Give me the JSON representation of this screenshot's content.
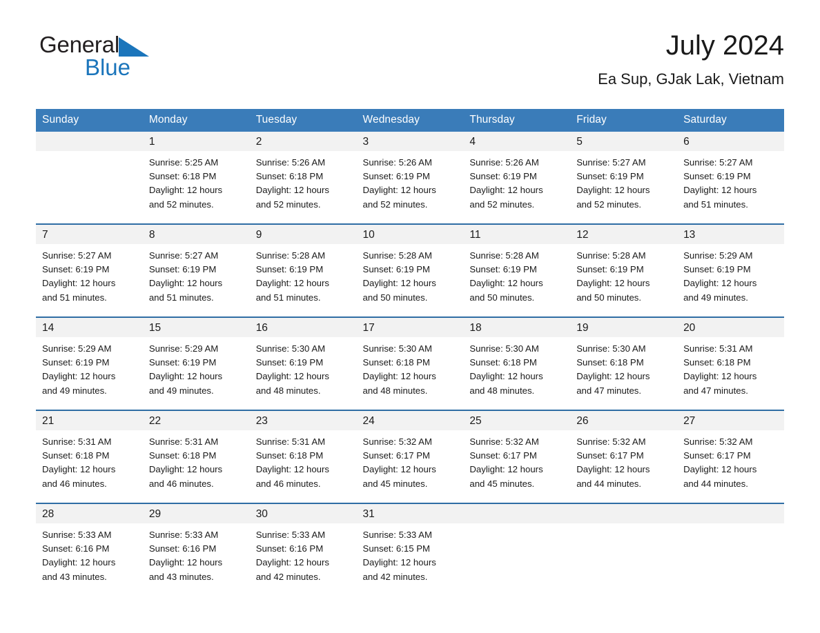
{
  "brand": {
    "name_part1": "General",
    "name_part2": "Blue",
    "accent_color": "#1b75bb",
    "triangle_icon": "brand-triangle-icon"
  },
  "header": {
    "title": "July 2024",
    "subtitle": "Ea Sup, GJak Lak, Vietnam"
  },
  "calendar": {
    "header_bg": "#3a7cb9",
    "row_divider_color": "#2e6da4",
    "daynum_band_bg": "#f2f2f2",
    "weekday_headers": [
      "Sunday",
      "Monday",
      "Tuesday",
      "Wednesday",
      "Thursday",
      "Friday",
      "Saturday"
    ],
    "weeks": [
      [
        {
          "day": "",
          "details": ""
        },
        {
          "day": "1",
          "details": "Sunrise: 5:25 AM\nSunset: 6:18 PM\nDaylight: 12 hours\nand 52 minutes."
        },
        {
          "day": "2",
          "details": "Sunrise: 5:26 AM\nSunset: 6:18 PM\nDaylight: 12 hours\nand 52 minutes."
        },
        {
          "day": "3",
          "details": "Sunrise: 5:26 AM\nSunset: 6:19 PM\nDaylight: 12 hours\nand 52 minutes."
        },
        {
          "day": "4",
          "details": "Sunrise: 5:26 AM\nSunset: 6:19 PM\nDaylight: 12 hours\nand 52 minutes."
        },
        {
          "day": "5",
          "details": "Sunrise: 5:27 AM\nSunset: 6:19 PM\nDaylight: 12 hours\nand 52 minutes."
        },
        {
          "day": "6",
          "details": "Sunrise: 5:27 AM\nSunset: 6:19 PM\nDaylight: 12 hours\nand 51 minutes."
        }
      ],
      [
        {
          "day": "7",
          "details": "Sunrise: 5:27 AM\nSunset: 6:19 PM\nDaylight: 12 hours\nand 51 minutes."
        },
        {
          "day": "8",
          "details": "Sunrise: 5:27 AM\nSunset: 6:19 PM\nDaylight: 12 hours\nand 51 minutes."
        },
        {
          "day": "9",
          "details": "Sunrise: 5:28 AM\nSunset: 6:19 PM\nDaylight: 12 hours\nand 51 minutes."
        },
        {
          "day": "10",
          "details": "Sunrise: 5:28 AM\nSunset: 6:19 PM\nDaylight: 12 hours\nand 50 minutes."
        },
        {
          "day": "11",
          "details": "Sunrise: 5:28 AM\nSunset: 6:19 PM\nDaylight: 12 hours\nand 50 minutes."
        },
        {
          "day": "12",
          "details": "Sunrise: 5:28 AM\nSunset: 6:19 PM\nDaylight: 12 hours\nand 50 minutes."
        },
        {
          "day": "13",
          "details": "Sunrise: 5:29 AM\nSunset: 6:19 PM\nDaylight: 12 hours\nand 49 minutes."
        }
      ],
      [
        {
          "day": "14",
          "details": "Sunrise: 5:29 AM\nSunset: 6:19 PM\nDaylight: 12 hours\nand 49 minutes."
        },
        {
          "day": "15",
          "details": "Sunrise: 5:29 AM\nSunset: 6:19 PM\nDaylight: 12 hours\nand 49 minutes."
        },
        {
          "day": "16",
          "details": "Sunrise: 5:30 AM\nSunset: 6:19 PM\nDaylight: 12 hours\nand 48 minutes."
        },
        {
          "day": "17",
          "details": "Sunrise: 5:30 AM\nSunset: 6:18 PM\nDaylight: 12 hours\nand 48 minutes."
        },
        {
          "day": "18",
          "details": "Sunrise: 5:30 AM\nSunset: 6:18 PM\nDaylight: 12 hours\nand 48 minutes."
        },
        {
          "day": "19",
          "details": "Sunrise: 5:30 AM\nSunset: 6:18 PM\nDaylight: 12 hours\nand 47 minutes."
        },
        {
          "day": "20",
          "details": "Sunrise: 5:31 AM\nSunset: 6:18 PM\nDaylight: 12 hours\nand 47 minutes."
        }
      ],
      [
        {
          "day": "21",
          "details": "Sunrise: 5:31 AM\nSunset: 6:18 PM\nDaylight: 12 hours\nand 46 minutes."
        },
        {
          "day": "22",
          "details": "Sunrise: 5:31 AM\nSunset: 6:18 PM\nDaylight: 12 hours\nand 46 minutes."
        },
        {
          "day": "23",
          "details": "Sunrise: 5:31 AM\nSunset: 6:18 PM\nDaylight: 12 hours\nand 46 minutes."
        },
        {
          "day": "24",
          "details": "Sunrise: 5:32 AM\nSunset: 6:17 PM\nDaylight: 12 hours\nand 45 minutes."
        },
        {
          "day": "25",
          "details": "Sunrise: 5:32 AM\nSunset: 6:17 PM\nDaylight: 12 hours\nand 45 minutes."
        },
        {
          "day": "26",
          "details": "Sunrise: 5:32 AM\nSunset: 6:17 PM\nDaylight: 12 hours\nand 44 minutes."
        },
        {
          "day": "27",
          "details": "Sunrise: 5:32 AM\nSunset: 6:17 PM\nDaylight: 12 hours\nand 44 minutes."
        }
      ],
      [
        {
          "day": "28",
          "details": "Sunrise: 5:33 AM\nSunset: 6:16 PM\nDaylight: 12 hours\nand 43 minutes."
        },
        {
          "day": "29",
          "details": "Sunrise: 5:33 AM\nSunset: 6:16 PM\nDaylight: 12 hours\nand 43 minutes."
        },
        {
          "day": "30",
          "details": "Sunrise: 5:33 AM\nSunset: 6:16 PM\nDaylight: 12 hours\nand 42 minutes."
        },
        {
          "day": "31",
          "details": "Sunrise: 5:33 AM\nSunset: 6:15 PM\nDaylight: 12 hours\nand 42 minutes."
        },
        {
          "day": "",
          "details": ""
        },
        {
          "day": "",
          "details": ""
        },
        {
          "day": "",
          "details": ""
        }
      ]
    ]
  }
}
